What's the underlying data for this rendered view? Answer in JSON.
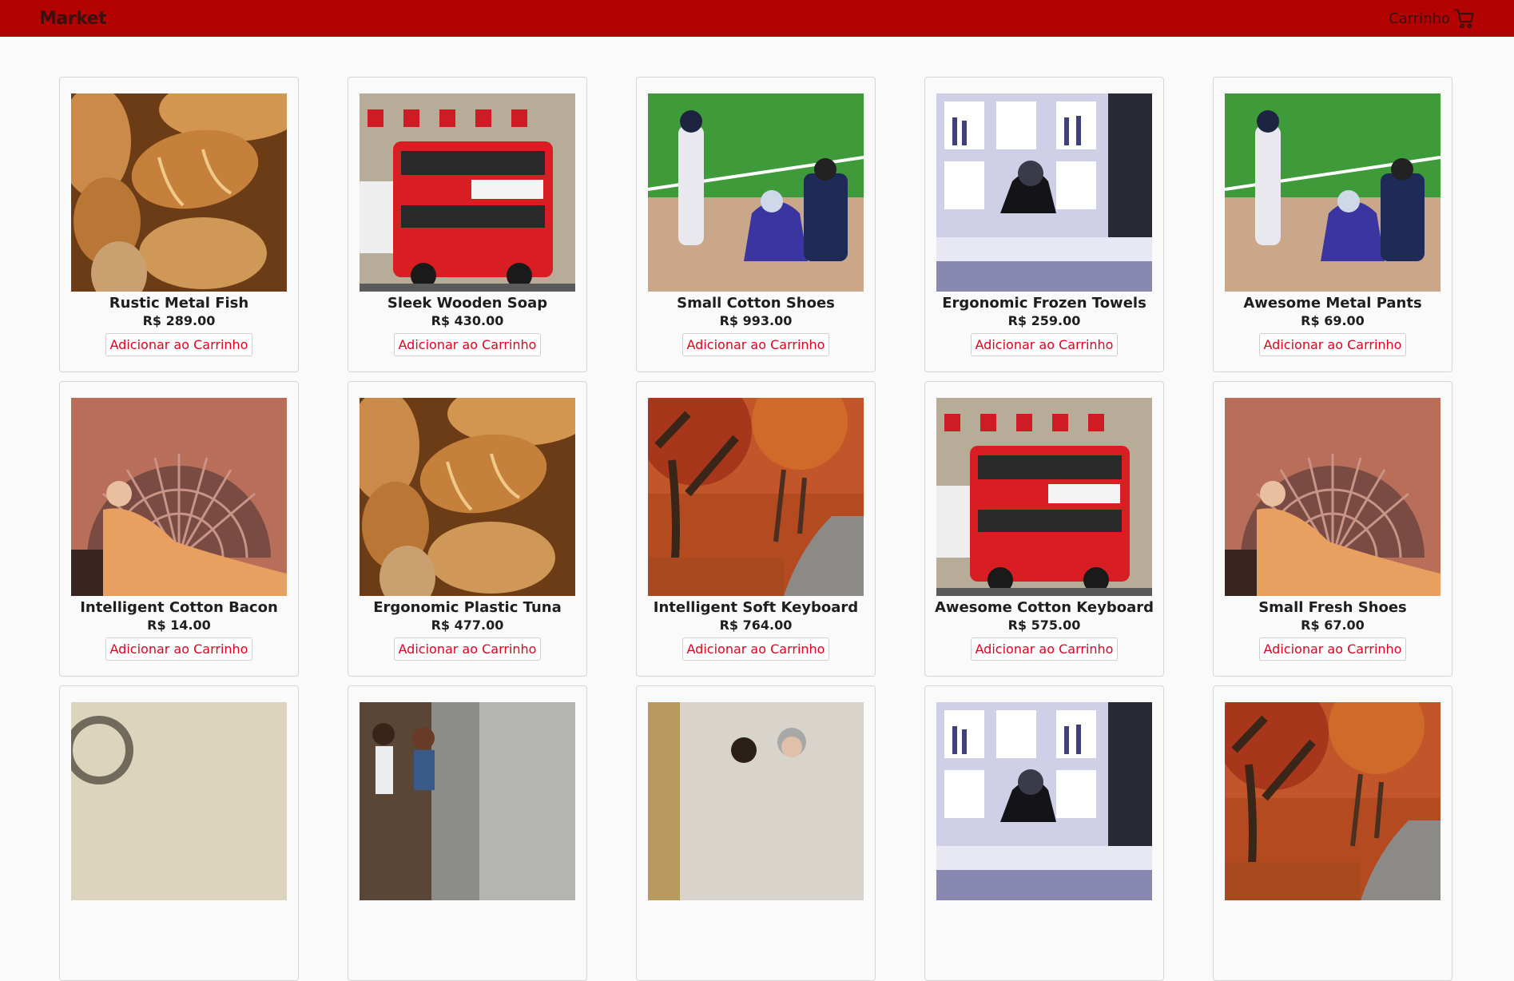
{
  "navbar": {
    "brand": "Market",
    "cart_label": "Carrinho",
    "color": "#b30000"
  },
  "product_button_label": "Adicionar ao Carrinho",
  "products": [
    {
      "name": "Rustic Metal Fish",
      "price": "R$ 289.00",
      "image": "bread"
    },
    {
      "name": "Sleek Wooden Soap",
      "price": "R$ 430.00",
      "image": "bus"
    },
    {
      "name": "Small Cotton Shoes",
      "price": "R$ 993.00",
      "image": "baseball"
    },
    {
      "name": "Ergonomic Frozen Towels",
      "price": "R$ 259.00",
      "image": "bar"
    },
    {
      "name": "Awesome Metal Pants",
      "price": "R$ 69.00",
      "image": "baseball"
    },
    {
      "name": "Intelligent Cotton Bacon",
      "price": "R$ 14.00",
      "image": "painting"
    },
    {
      "name": "Ergonomic Plastic Tuna",
      "price": "R$ 477.00",
      "image": "bread"
    },
    {
      "name": "Intelligent Soft Keyboard",
      "price": "R$ 764.00",
      "image": "autumn"
    },
    {
      "name": "Awesome Cotton Keyboard",
      "price": "R$ 575.00",
      "image": "bus"
    },
    {
      "name": "Small Fresh Shoes",
      "price": "R$ 67.00",
      "image": "painting"
    },
    {
      "name": "",
      "price": "",
      "image": "machine"
    },
    {
      "name": "",
      "price": "",
      "image": "street"
    },
    {
      "name": "",
      "price": "",
      "image": "people"
    },
    {
      "name": "",
      "price": "",
      "image": "bar"
    },
    {
      "name": "",
      "price": "",
      "image": "autumn"
    }
  ]
}
